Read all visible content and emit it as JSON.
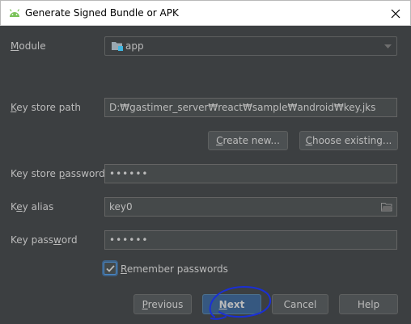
{
  "window": {
    "title": "Generate Signed Bundle or APK"
  },
  "module": {
    "label": "Module",
    "mnemonic": "M",
    "value": "app"
  },
  "keystore": {
    "path_label": "Key store path",
    "path_mnemonic": "K",
    "path_value": "D:₩gastimer_server₩react₩sample₩android₩key.jks",
    "create_new": "Create new...",
    "create_mnemonic": "C",
    "choose_existing": "Choose existing...",
    "choose_mnemonic": "C",
    "password_label": "Key store password",
    "password_mnemonic": "p",
    "password_value": "••••••"
  },
  "key": {
    "alias_label": "Key alias",
    "alias_mnemonic": "e",
    "alias_value": "key0",
    "password_label": "Key password",
    "password_mnemonic": "w",
    "password_value": "••••••"
  },
  "remember": {
    "label": "Remember passwords",
    "mnemonic": "R",
    "checked": true
  },
  "buttons": {
    "previous": "Previous",
    "next": "Next",
    "cancel": "Cancel",
    "help": "Help"
  },
  "icons": {
    "close": "close-icon",
    "android": "android-icon",
    "folder": "folder-icon",
    "module": "module-folder-icon"
  },
  "colors": {
    "accent": "#365880",
    "annotation": "#1a2fd6"
  }
}
